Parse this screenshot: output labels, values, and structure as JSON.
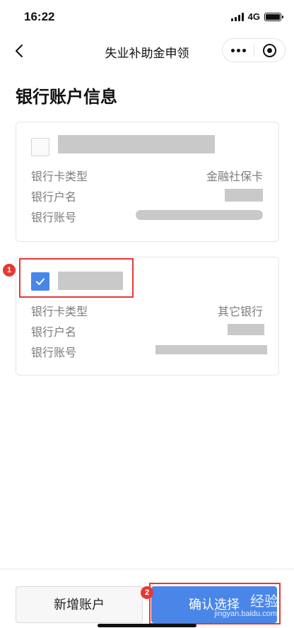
{
  "status_bar": {
    "time": "16:22",
    "network": "4G",
    "icons": [
      "signal-icon",
      "battery-icon"
    ]
  },
  "nav": {
    "title": "失业补助金申领",
    "icons": [
      "back-icon",
      "more-icon",
      "target-icon"
    ]
  },
  "page": {
    "title": "银行账户信息"
  },
  "accounts": [
    {
      "selected": false,
      "rows": [
        {
          "label": "银行卡类型",
          "value": "金融社保卡"
        },
        {
          "label": "银行户名",
          "value": ""
        },
        {
          "label": "银行账号",
          "value": ""
        }
      ]
    },
    {
      "selected": true,
      "rows": [
        {
          "label": "银行卡类型",
          "value": "其它银行"
        },
        {
          "label": "银行户名",
          "value": ""
        },
        {
          "label": "银行账号",
          "value": ""
        }
      ]
    }
  ],
  "annotations": {
    "step1": "1",
    "step2": "2",
    "color": "#e53935"
  },
  "buttons": {
    "add_account": "新增账户",
    "confirm": "确认选择"
  },
  "watermark": {
    "text": "经验",
    "url": "jingyan.baidu.com"
  },
  "colors": {
    "accent": "#4a86e8",
    "masked": "#c9c9c9"
  }
}
